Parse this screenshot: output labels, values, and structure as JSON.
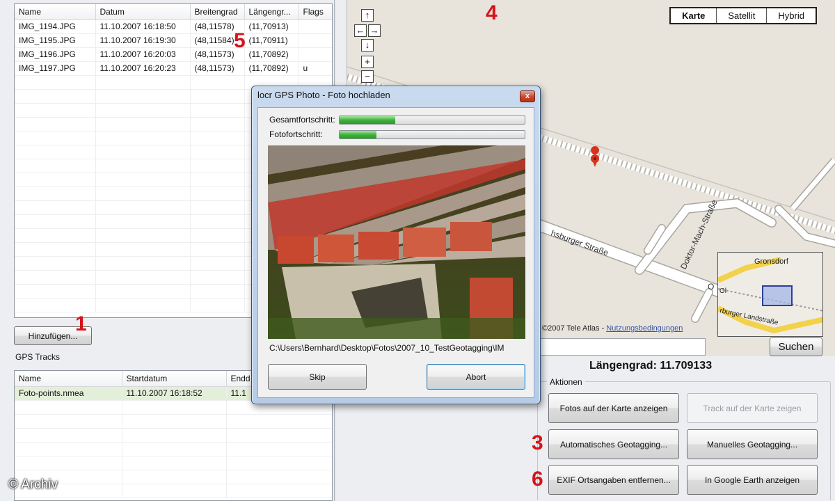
{
  "photos_table": {
    "columns": [
      "Name",
      "Datum",
      "Breitengrad",
      "Längengr...",
      "Flags"
    ],
    "rows": [
      [
        "IMG_1194.JPG",
        "11.10.2007 16:18:50",
        "(48,11578)",
        "(11,70913)",
        ""
      ],
      [
        "IMG_1195.JPG",
        "11.10.2007 16:19:30",
        "(48,11584)",
        "(11,70911)",
        ""
      ],
      [
        "IMG_1196.JPG",
        "11.10.2007 16:20:03",
        "(48,11573)",
        "(11,70892)",
        ""
      ],
      [
        "IMG_1197.JPG",
        "11.10.2007 16:20:23",
        "(48,11573)",
        "(11,70892)",
        "u"
      ]
    ]
  },
  "add_button": "Hinzufügen...",
  "gps_tracks": {
    "label": "GPS Tracks",
    "columns": [
      "Name",
      "Startdatum",
      "Endd"
    ],
    "rows": [
      [
        "Foto-points.nmea",
        "11.10.2007 16:18:52",
        "11.1"
      ]
    ]
  },
  "markers": {
    "m1": "1",
    "m3": "3",
    "m4": "4",
    "m5": "5",
    "m6": "6"
  },
  "copyright": "© Archiv",
  "map": {
    "types": [
      "Karte",
      "Satellit",
      "Hybrid"
    ],
    "nav": {
      "up": "↑",
      "left": "←",
      "right": "→",
      "down": "↓",
      "zoom_in": "+",
      "zoom_out": "−"
    },
    "streets": [
      "hsburger Straße",
      "Doktor-Mach-Straße",
      "O"
    ],
    "attribution": "©2007 Tele Atlas - ",
    "terms": "Nutzungsbedingungen",
    "overview_labels": [
      "Gronsdorf",
      "rburger Landstraße",
      "Ol"
    ],
    "search_button": "Suchen",
    "longitude_text": "Längengrad: 11.709133"
  },
  "actions": {
    "label": "Aktionen",
    "show_photos": "Fotos auf der Karte anzeigen",
    "show_track": "Track auf der Karte zeigen",
    "auto_geotag": "Automatisches Geotagging...",
    "manual_geotag": "Manuelles Geotagging...",
    "remove_exif": "EXIF Ortsangaben entfernen...",
    "google_earth": "In Google Earth anzeigen"
  },
  "dialog": {
    "title": "locr GPS Photo - Foto hochladen",
    "close": "x",
    "total_label": "Gesamtfortschritt:",
    "total_progress": 0.3,
    "photo_label": "Fotofortschritt:",
    "photo_progress": 0.2,
    "path": "C:\\Users\\Bernhard\\Desktop\\Fotos\\2007_10_TestGeotagging\\IM",
    "skip": "Skip",
    "abort": "Abort"
  },
  "colors": {
    "marker_red": "#d3151b",
    "progress_green": "#3fb33c",
    "selected_row": "#e4efd9"
  }
}
